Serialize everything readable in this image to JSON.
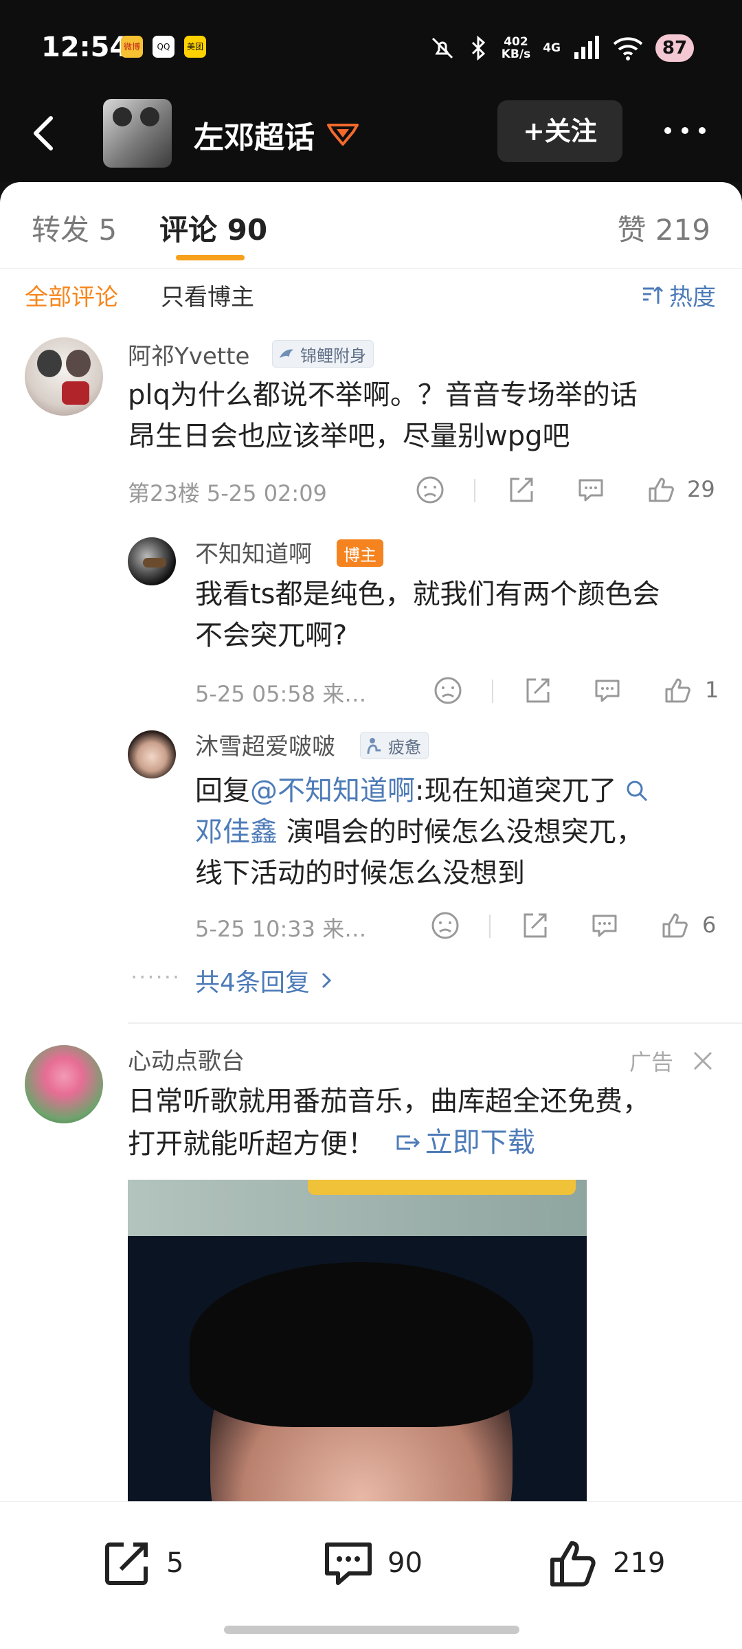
{
  "status_bar": {
    "time": "12:54",
    "apps": [
      "微博",
      "QQ",
      "美团"
    ],
    "net_speed_value": "402",
    "net_speed_unit": "KB/s",
    "network": "4G",
    "battery": "87"
  },
  "nav": {
    "topic_title": "左邓超话",
    "follow_label": "+关注"
  },
  "tabs": {
    "repost": "转发 5",
    "comment": "评论 90",
    "like": "赞 219"
  },
  "filters": {
    "all": "全部评论",
    "author_only": "只看博主",
    "sort": "热度"
  },
  "comment1": {
    "username": "阿祁Yvette",
    "badge": "锦鲤附身",
    "line1": "plq为什么都说不举啊。？音音专场举的话",
    "line2": "昂生日会也应该举吧，尽量别wpg吧",
    "meta": "第23楼  5-25 02:09",
    "likes": "29"
  },
  "reply1": {
    "username": "不知知道啊",
    "badge": "博主",
    "line1": "我看ts都是纯色，就我们有两个颜色会",
    "line2": "不会突兀啊?",
    "meta": "5-25 05:58  来…",
    "likes": "1"
  },
  "reply2": {
    "username": "沐雪超爱啵啵",
    "badge": "疲惫",
    "prefix": "回复",
    "mention": "@不知知道啊",
    "line1_rest": ":现在知道突兀了",
    "topic": "邓佳鑫",
    "line2_rest": " 演唱会的时候怎么没想突兀，",
    "line3": "线下活动的时候怎么没想到",
    "meta": "5-25 10:33  来…",
    "likes": "6"
  },
  "more_replies": "共4条回复",
  "ad": {
    "username": "心动点歌台",
    "label": "广告",
    "line1": "日常听歌就用番茄音乐，曲库超全还免费，",
    "line2_text": "打开就能听超方便！",
    "cta": "立即下载"
  },
  "bottom_bar": {
    "repost_count": "5",
    "comment_count": "90",
    "like_count": "219"
  }
}
